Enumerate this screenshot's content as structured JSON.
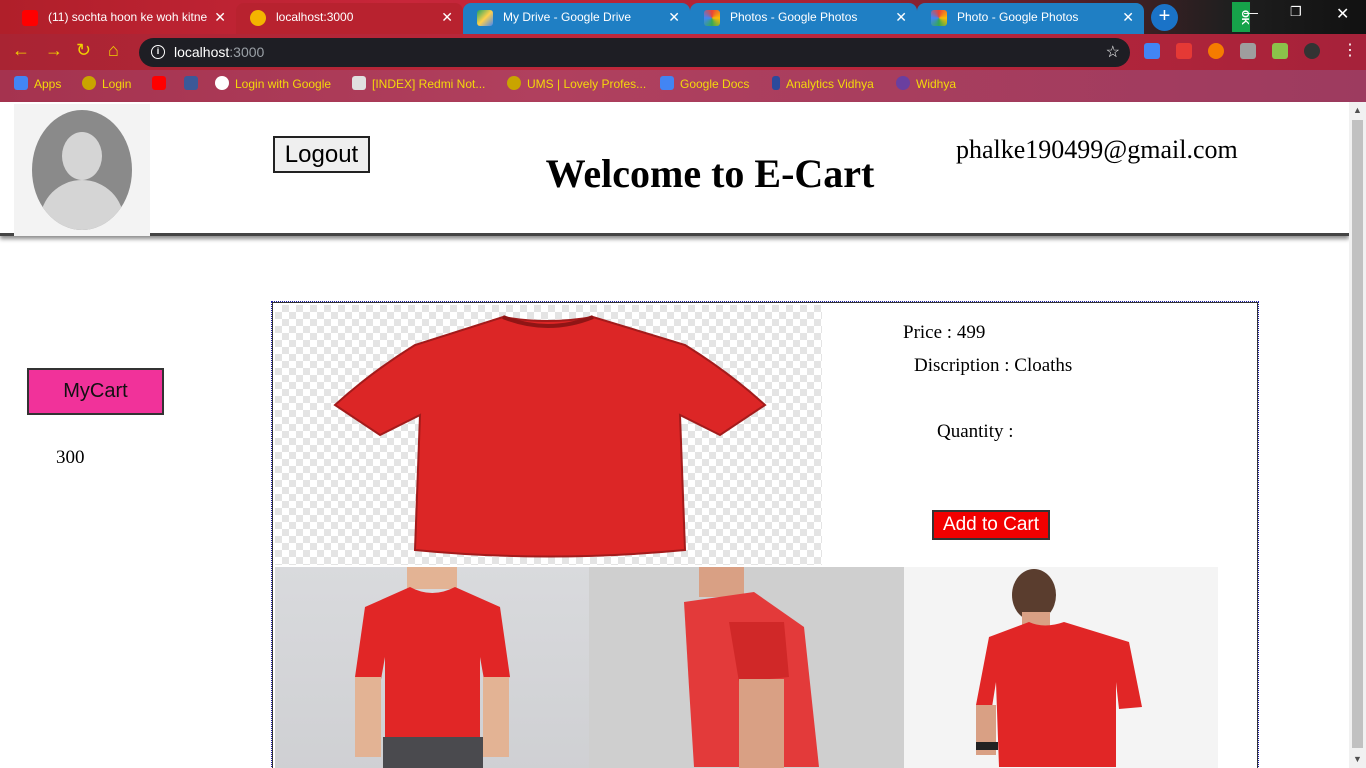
{
  "browser": {
    "tabs": [
      {
        "title": "(11) sochta hoon ke woh kitne",
        "favicon_color": "#ff0000",
        "favicon": "youtube-icon"
      },
      {
        "title": "localhost:3000",
        "favicon_color": "#f4b400",
        "favicon": "react-icon"
      },
      {
        "title": "My Drive - Google Drive",
        "favicon_color": "#1fa463",
        "favicon": "drive-icon"
      },
      {
        "title": "Photos - Google Photos",
        "favicon_color": "#ea4335",
        "favicon": "photos-icon"
      },
      {
        "title": "Photo - Google Photos",
        "favicon_color": "#ea4335",
        "favicon": "photos-icon"
      }
    ],
    "active_tab": 1,
    "url_host": "localhost",
    "url_port": ":3000",
    "bookmarks": [
      {
        "label": "Apps",
        "icon_color": "#4285f4"
      },
      {
        "label": "Login",
        "icon_color": "#c9a400"
      },
      {
        "label": "",
        "icon_color": "#ff0000"
      },
      {
        "label": "",
        "icon_color": "#3b5998"
      },
      {
        "label": "Login with Google",
        "icon_color": "#ffffff"
      },
      {
        "label": "[INDEX] Redmi Not...",
        "icon_color": "#e0e0e0"
      },
      {
        "label": "UMS | Lovely Profes...",
        "icon_color": "#c9a400"
      },
      {
        "label": "Google Docs",
        "icon_color": "#4285f4"
      },
      {
        "label": "Analytics Vidhya",
        "icon_color": "#2b4a9c"
      },
      {
        "label": "Widhya",
        "icon_color": "#6a3fa0"
      }
    ]
  },
  "header": {
    "logout_label": "Logout",
    "welcome_title": "Welcome to E-Cart",
    "user_email": "phalke190499@gmail.com"
  },
  "sidebar": {
    "mycart_label": "MyCart",
    "cart_value": "300"
  },
  "product": {
    "price_text": "Price : 499",
    "description_text": "Discription : Cloaths",
    "quantity_text": "Quantity :",
    "add_to_cart_label": "Add to Cart",
    "shirt_color": "#e02828"
  }
}
